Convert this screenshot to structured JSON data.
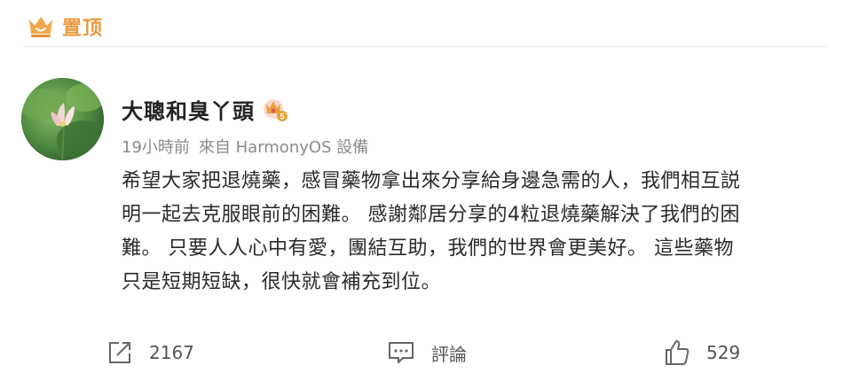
{
  "pinned": {
    "label": "置顶",
    "icon": "crown-icon",
    "color": "#e99b3f"
  },
  "post": {
    "author": {
      "name": "大聰和臭丫頭",
      "badge_icon": "vip-crown-badge-icon",
      "avatar": "lotus-avatar"
    },
    "meta": {
      "time": "19小時前",
      "source": "來自 HarmonyOS 設備"
    },
    "lines": [
      "希望大家把退燒藥，感冒藥物拿出來分享給身邊急需的人，我們相互説",
      "明一起去克服眼前的困難。 感謝鄰居分享的4粒退燒藥解決了我們的困",
      "難。 只要人人心中有愛，團結互助，我們的世界會更美好。 這些藥物",
      "只是短期短缺，很快就會補充到位。"
    ],
    "actions": {
      "share": {
        "count": "2167",
        "icon": "share-icon"
      },
      "comment": {
        "label": "評論",
        "icon": "comment-icon"
      },
      "like": {
        "count": "529",
        "icon": "thumbs-up-icon"
      }
    }
  }
}
